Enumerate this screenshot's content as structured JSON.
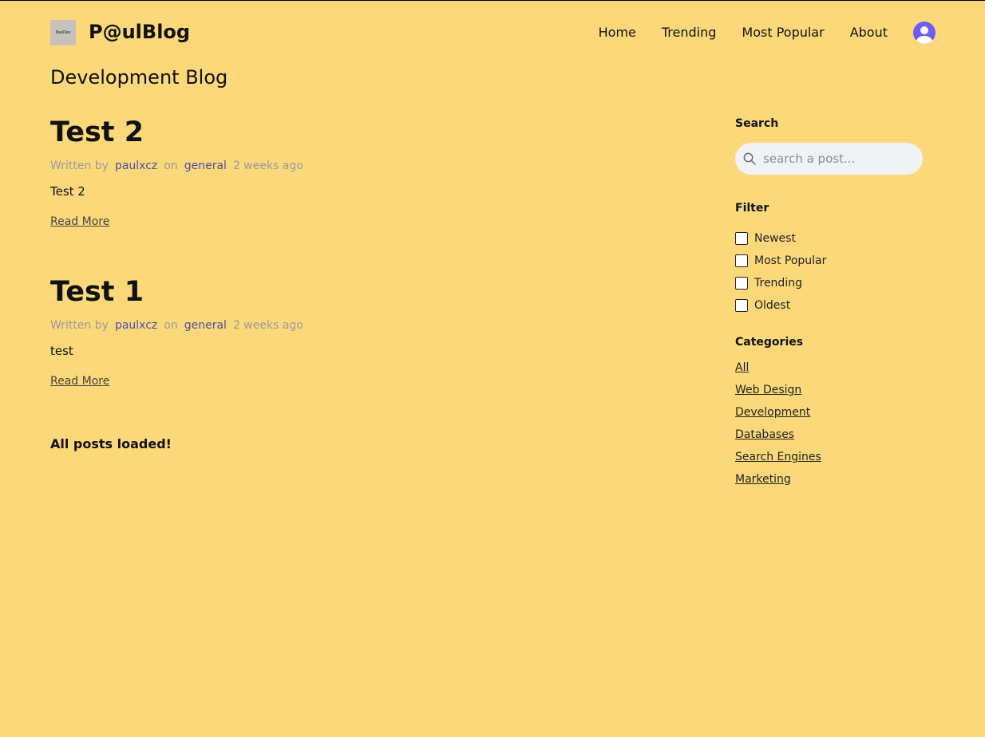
{
  "header": {
    "logo_text": "PaulDev",
    "brand": "P@ulBlog",
    "nav": [
      "Home",
      "Trending",
      "Most Popular",
      "About"
    ]
  },
  "page_title": "Development Blog",
  "posts": [
    {
      "title": "Test 2",
      "written_by_label": "Written by",
      "author": "paulxcz",
      "on_label": "on",
      "category": "general",
      "time": "2 weeks ago",
      "excerpt": "Test 2",
      "read_more": "Read More"
    },
    {
      "title": "Test 1",
      "written_by_label": "Written by",
      "author": "paulxcz",
      "on_label": "on",
      "category": "general",
      "time": "2 weeks ago",
      "excerpt": "test",
      "read_more": "Read More"
    }
  ],
  "all_loaded": "All posts loaded!",
  "sidebar": {
    "search_heading": "Search",
    "search_placeholder": "search a post...",
    "filter_heading": "Filter",
    "filters": [
      "Newest",
      "Most Popular",
      "Trending",
      "Oldest"
    ],
    "categories_heading": "Categories",
    "categories": [
      "All",
      "Web Design",
      "Development",
      "Databases",
      "Search Engines",
      "Marketing"
    ]
  },
  "colors": {
    "background": "#fbd97a",
    "accent_link": "#4b4f9e",
    "avatar": "#6d5cf6"
  },
  "icons": [
    "search-icon",
    "user-avatar-icon"
  ]
}
